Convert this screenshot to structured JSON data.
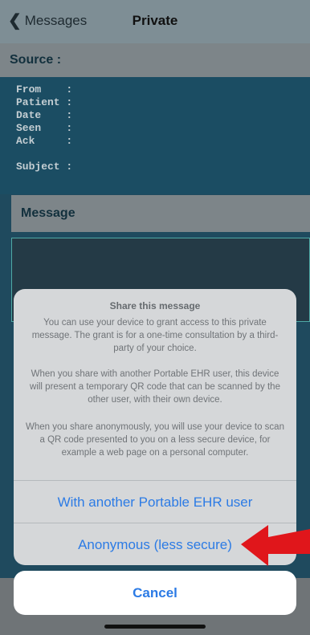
{
  "nav": {
    "back_label": "Messages",
    "title": "Private"
  },
  "source": {
    "header": "Source :",
    "fields": [
      "From    :",
      "Patient :",
      "Date    :",
      "Seen    :",
      "Ack     :",
      "Subject :"
    ]
  },
  "message": {
    "header": "Message"
  },
  "sheet": {
    "title": "Share this message",
    "paragraph1": "You can use your device to grant access to this private message. The grant is for a one-time consultation by a third-party of your choice.",
    "paragraph2": "When you share with another Portable EHR user, this device will present a temporary QR code that can be scanned by the other user, with their own device.",
    "paragraph3": "When you share anonymously, you will use your device to scan a QR code presented to you on a less secure device, for example a web page on a personal computer.",
    "options": [
      "With another Portable EHR user",
      "Anonymous (less secure)"
    ],
    "cancel_label": "Cancel"
  },
  "colors": {
    "accent": "#2c7be5",
    "arrow": "#e0161b",
    "background": "#1f4a5e"
  },
  "icons": {
    "back": "chevron-left-icon",
    "annotation": "red-arrow-icon",
    "tabbar_left": "square-icon",
    "tabbar_right": "paperclip-icon"
  }
}
